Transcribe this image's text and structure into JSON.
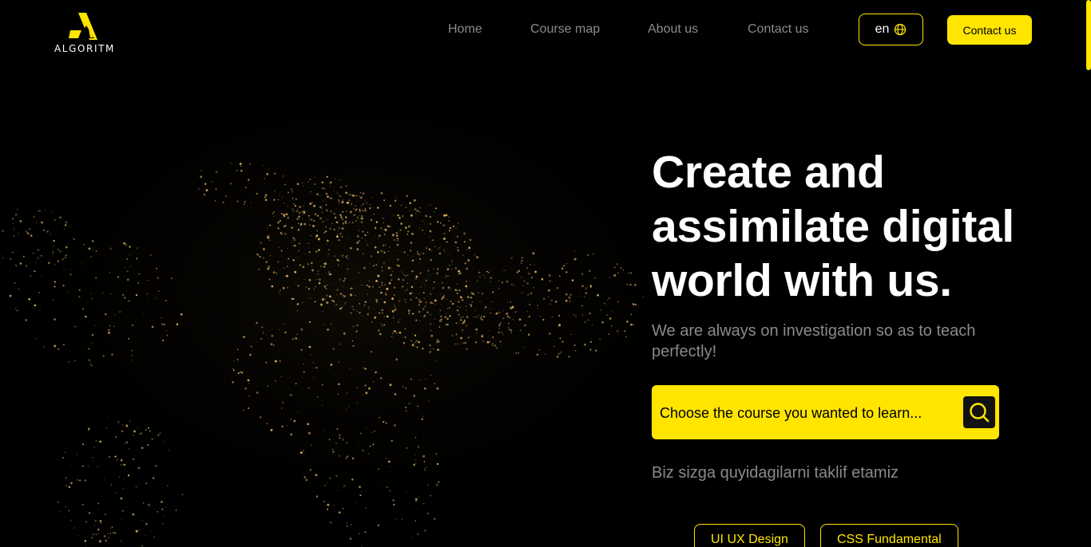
{
  "brand": {
    "name": "ALGORITM",
    "accent": "#ffe500"
  },
  "nav": {
    "links": [
      "Home",
      "Course map",
      "About us",
      "Contact us"
    ],
    "lang_label": "en",
    "cta_label": "Contact us"
  },
  "hero": {
    "title": "Create and assimilate digital world with us.",
    "subtitle": "We are always on investigation so as to teach perfectly!",
    "search_placeholder": "Choose the course you wanted to learn...",
    "offer_text": "Biz sizga quyidagilarni taklif etamiz",
    "chips": [
      "UI UX Design",
      "CSS Fundamental"
    ]
  }
}
